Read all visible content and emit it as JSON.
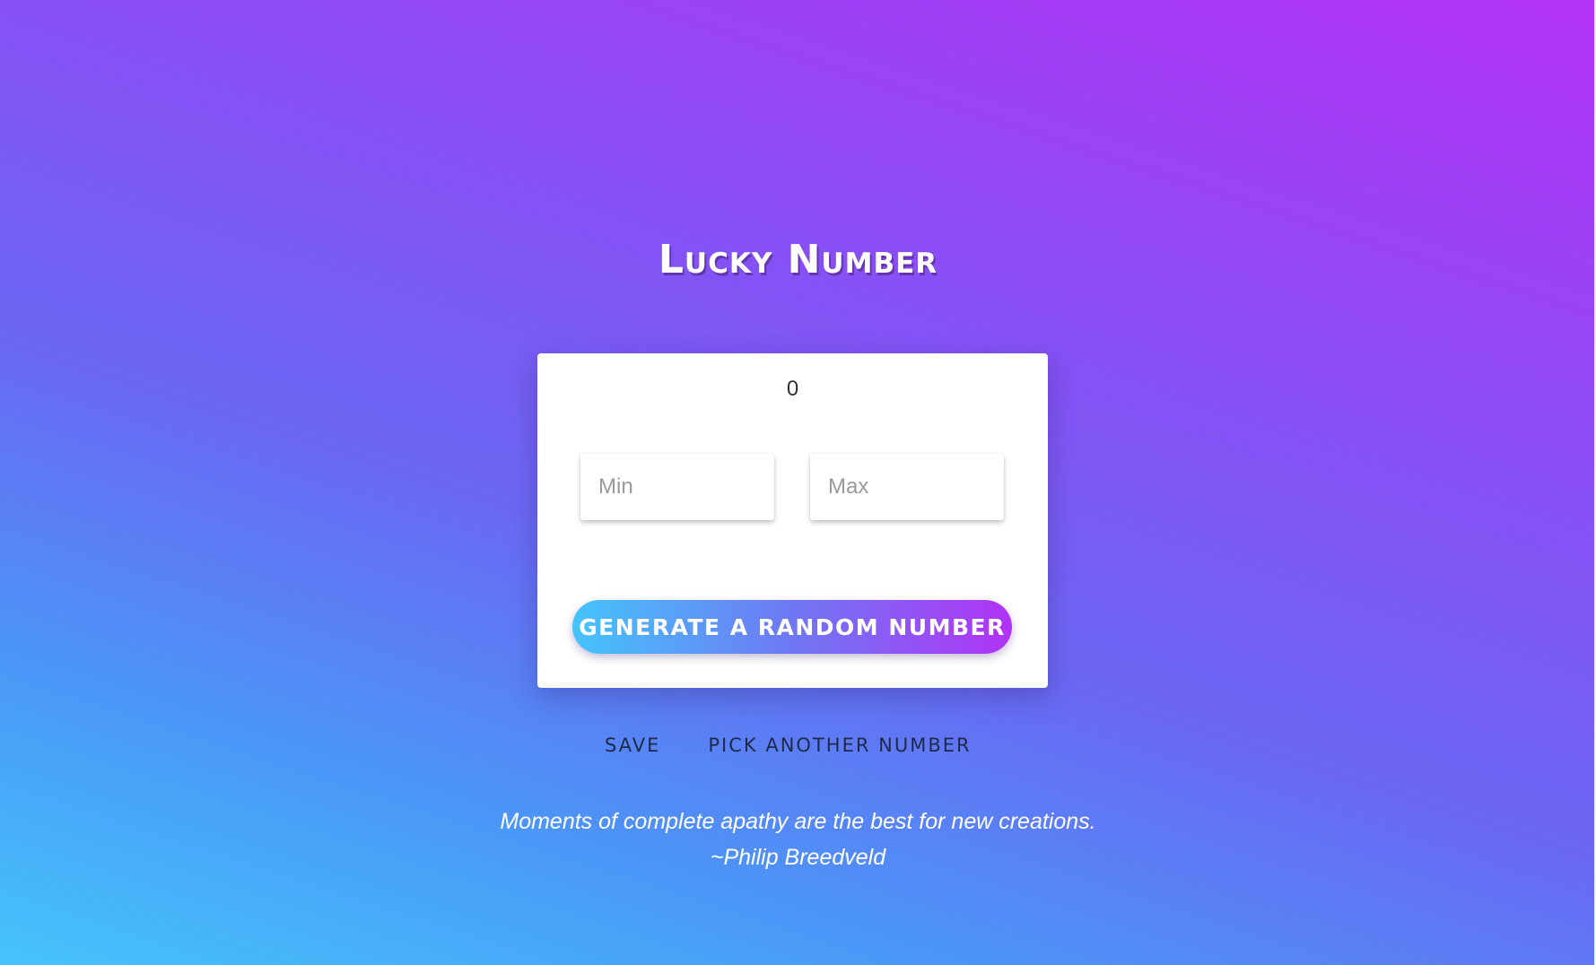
{
  "app": {
    "title": "Lucky Number"
  },
  "card": {
    "result_value": "0",
    "min_field": {
      "value": "",
      "placeholder": "Min"
    },
    "max_field": {
      "value": "",
      "placeholder": "Max"
    },
    "generate_button_label": "GENERATE A RANDOM NUMBER"
  },
  "actions": {
    "save_label": "SAVE",
    "pick_another_label": "PICK ANOTHER NUMBER"
  },
  "quote": {
    "text": "Moments of complete apathy are the best for new creations.",
    "author": "~Philip Breedveld"
  },
  "colors": {
    "background_top": "#b433f5",
    "background_bottom": "#45c4fb",
    "button_gradient_start": "#45c4fb",
    "button_gradient_end": "#b133f5",
    "card": "#ffffff"
  }
}
